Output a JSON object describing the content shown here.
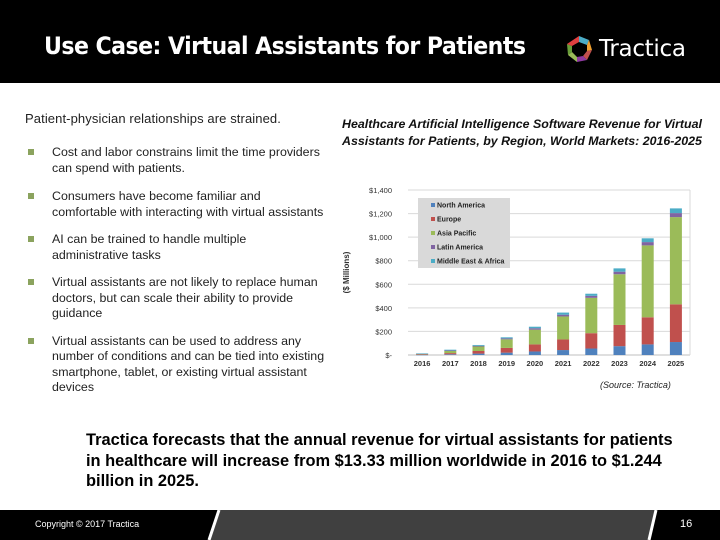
{
  "header": {
    "title": "Use Case: Virtual Assistants for Patients",
    "logo_text": "Tractica",
    "logo_icon": "tractica-logo-icon"
  },
  "left": {
    "intro": "Patient-physician relationships are strained.",
    "bullets": [
      "Cost and labor constrains limit the time providers can spend with patients.",
      "Consumers have become familiar and comfortable with interacting with virtual assistants",
      "AI can be trained to handle multiple administrative tasks",
      "Virtual assistants are not likely to replace human doctors, but can scale their ability to provide guidance",
      "Virtual assistants can be used to address any number of conditions and can be tied into existing smartphone, tablet, or existing virtual assistant devices"
    ]
  },
  "chart_data": {
    "type": "bar",
    "stacked": true,
    "title": "Healthcare Artificial Intelligence Software Revenue for Virtual Assistants for Patients, by Region, World Markets: 2016-2025",
    "xlabel": "",
    "ylabel": "($ Millions)",
    "ylim": [
      0,
      1400
    ],
    "yticks": [
      0,
      200,
      400,
      600,
      800,
      1000,
      1200,
      1400
    ],
    "ytick_labels": [
      "$-",
      "$200",
      "$400",
      "$600",
      "$800",
      "$1,000",
      "$1,200",
      "$1,400"
    ],
    "grid": true,
    "legend_position": "top-left",
    "categories": [
      "2016",
      "2017",
      "2018",
      "2019",
      "2020",
      "2021",
      "2022",
      "2023",
      "2024",
      "2025"
    ],
    "series": [
      {
        "name": "North America",
        "color": "#4f81bd",
        "values": [
          2,
          6,
          12,
          20,
          30,
          42,
          55,
          75,
          90,
          110
        ]
      },
      {
        "name": "Europe",
        "color": "#c0504d",
        "values": [
          3,
          10,
          22,
          40,
          60,
          90,
          130,
          180,
          230,
          320
        ]
      },
      {
        "name": "Asia Pacific",
        "color": "#9bbb59",
        "values": [
          5,
          18,
          38,
          73,
          125,
          195,
          300,
          430,
          610,
          740
        ]
      },
      {
        "name": "Latin America",
        "color": "#8064a2",
        "values": [
          1.5,
          5,
          6,
          8,
          12,
          15,
          17,
          22,
          28,
          34
        ]
      },
      {
        "name": "Middle East & Africa",
        "color": "#4bacc6",
        "values": [
          1.83,
          6,
          7,
          9,
          13,
          18,
          18,
          28,
          32,
          40
        ]
      }
    ],
    "source": "(Source: Tractica)"
  },
  "summary": "Tractica forecasts that the annual revenue for virtual assistants for patients in healthcare will increase from $13.33 million worldwide in 2016 to $1.244 billion in 2025.",
  "footer": {
    "copyright": "Copyright © 2017 Tractica",
    "page_number": "16"
  }
}
